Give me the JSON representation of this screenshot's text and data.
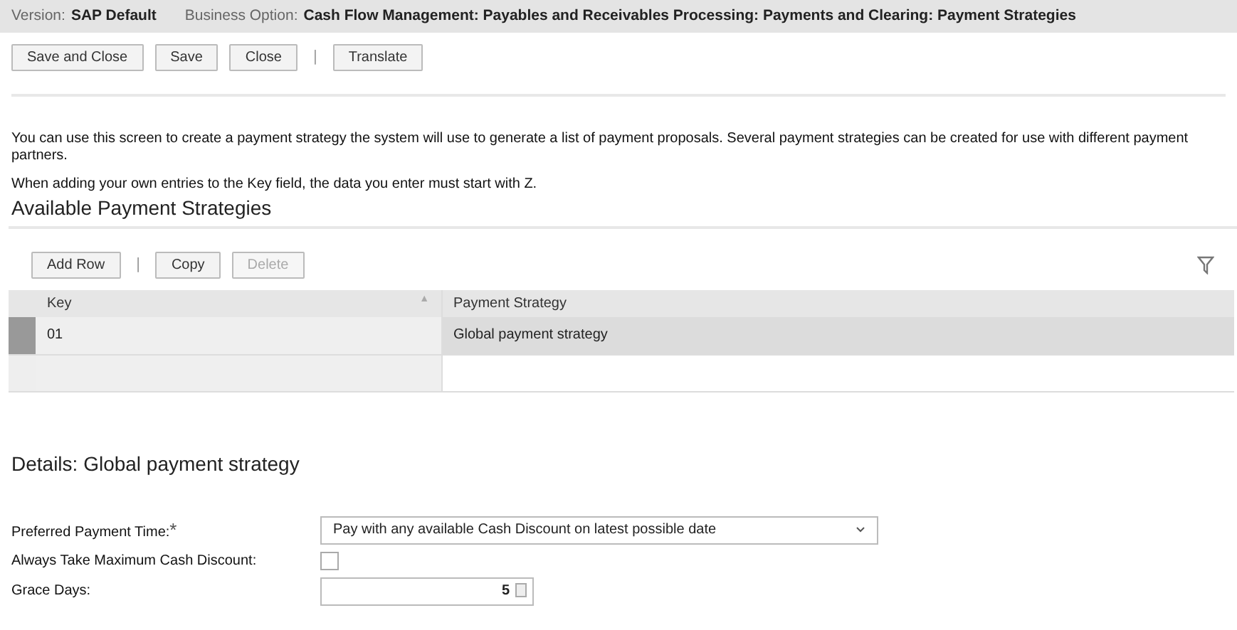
{
  "header": {
    "version_label": "Version:",
    "version": "SAP Default",
    "option_label": "Business Option:",
    "option": "Cash Flow Management: Payables and Receivables Processing: Payments and Clearing: Payment Strategies"
  },
  "toolbar": [
    {
      "label": "Save and Close",
      "disabled": false
    },
    {
      "label": "Save",
      "disabled": false
    },
    {
      "label": "Close",
      "disabled": false
    },
    {
      "kind": "separator",
      "label": "|"
    },
    {
      "label": "Translate",
      "disabled": false
    }
  ],
  "intro": [
    "You can use this screen to create a payment strategy the system will use to generate a list of payment proposals. Several payment strategies can be created for use with different payment partners.",
    "When adding your own entries to the Key field, the data you enter must start with Z."
  ],
  "table": {
    "title": "Available Payment Strategies",
    "toolbar": [
      {
        "label": "Add Row",
        "disabled": false
      },
      {
        "kind": "separator",
        "label": "|"
      },
      {
        "label": "Copy",
        "disabled": false
      },
      {
        "label": "Delete",
        "disabled": true
      }
    ],
    "columns": [
      {
        "label": "Key",
        "sort_icon": "▲"
      },
      {
        "label": "Payment Strategy"
      }
    ],
    "rows": [
      {
        "cells": [
          "01",
          "Global payment strategy"
        ],
        "selected": true
      }
    ]
  },
  "details": {
    "title": "Details: Global payment strategy",
    "fields": [
      {
        "kind": "select",
        "label": "Preferred Payment Time:",
        "required_mark": "*",
        "value": "Pay with any available Cash Discount on latest possible date"
      },
      {
        "kind": "checkbox",
        "label": "Always Take Maximum Cash Discount:",
        "checked": false
      },
      {
        "kind": "number",
        "label": "Grace Days:",
        "value": "5"
      }
    ]
  }
}
